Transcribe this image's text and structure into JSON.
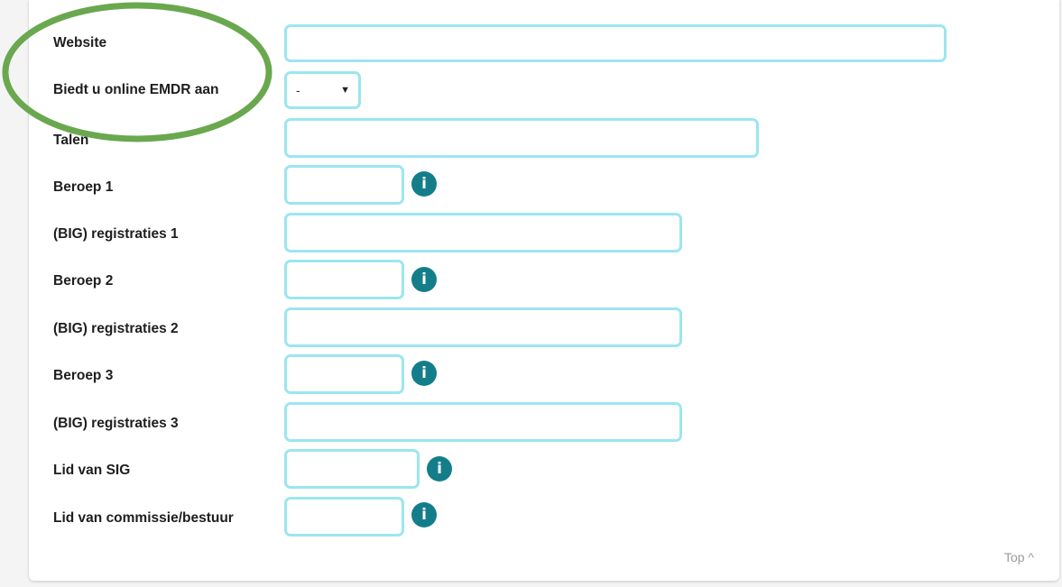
{
  "form": {
    "fields": [
      {
        "label": "Website",
        "value": ""
      },
      {
        "label": "Biedt u online EMDR aan",
        "selected": "-",
        "options": [
          "-"
        ]
      },
      {
        "label": "Talen",
        "value": ""
      },
      {
        "label": "Beroep 1",
        "value": "",
        "info_icon": "info-icon"
      },
      {
        "label": "(BIG) registraties 1",
        "value": ""
      },
      {
        "label": "Beroep 2",
        "value": "",
        "info_icon": "info-icon"
      },
      {
        "label": "(BIG) registraties 2",
        "value": ""
      },
      {
        "label": "Beroep 3",
        "value": "",
        "info_icon": "info-icon"
      },
      {
        "label": "(BIG) registraties 3",
        "value": ""
      },
      {
        "label": "Lid van SIG",
        "value": "",
        "info_icon": "info-icon"
      },
      {
        "label": "Lid van commissie/bestuur",
        "value": "",
        "info_icon": "info-icon"
      }
    ],
    "select_arrow": "▼",
    "info_glyph": "i"
  },
  "footer": {
    "top_link": "Top ^"
  },
  "colors": {
    "input_border": "#9be6f0",
    "info_bg": "#137e8a",
    "highlight_ellipse": "#6aa84f"
  }
}
